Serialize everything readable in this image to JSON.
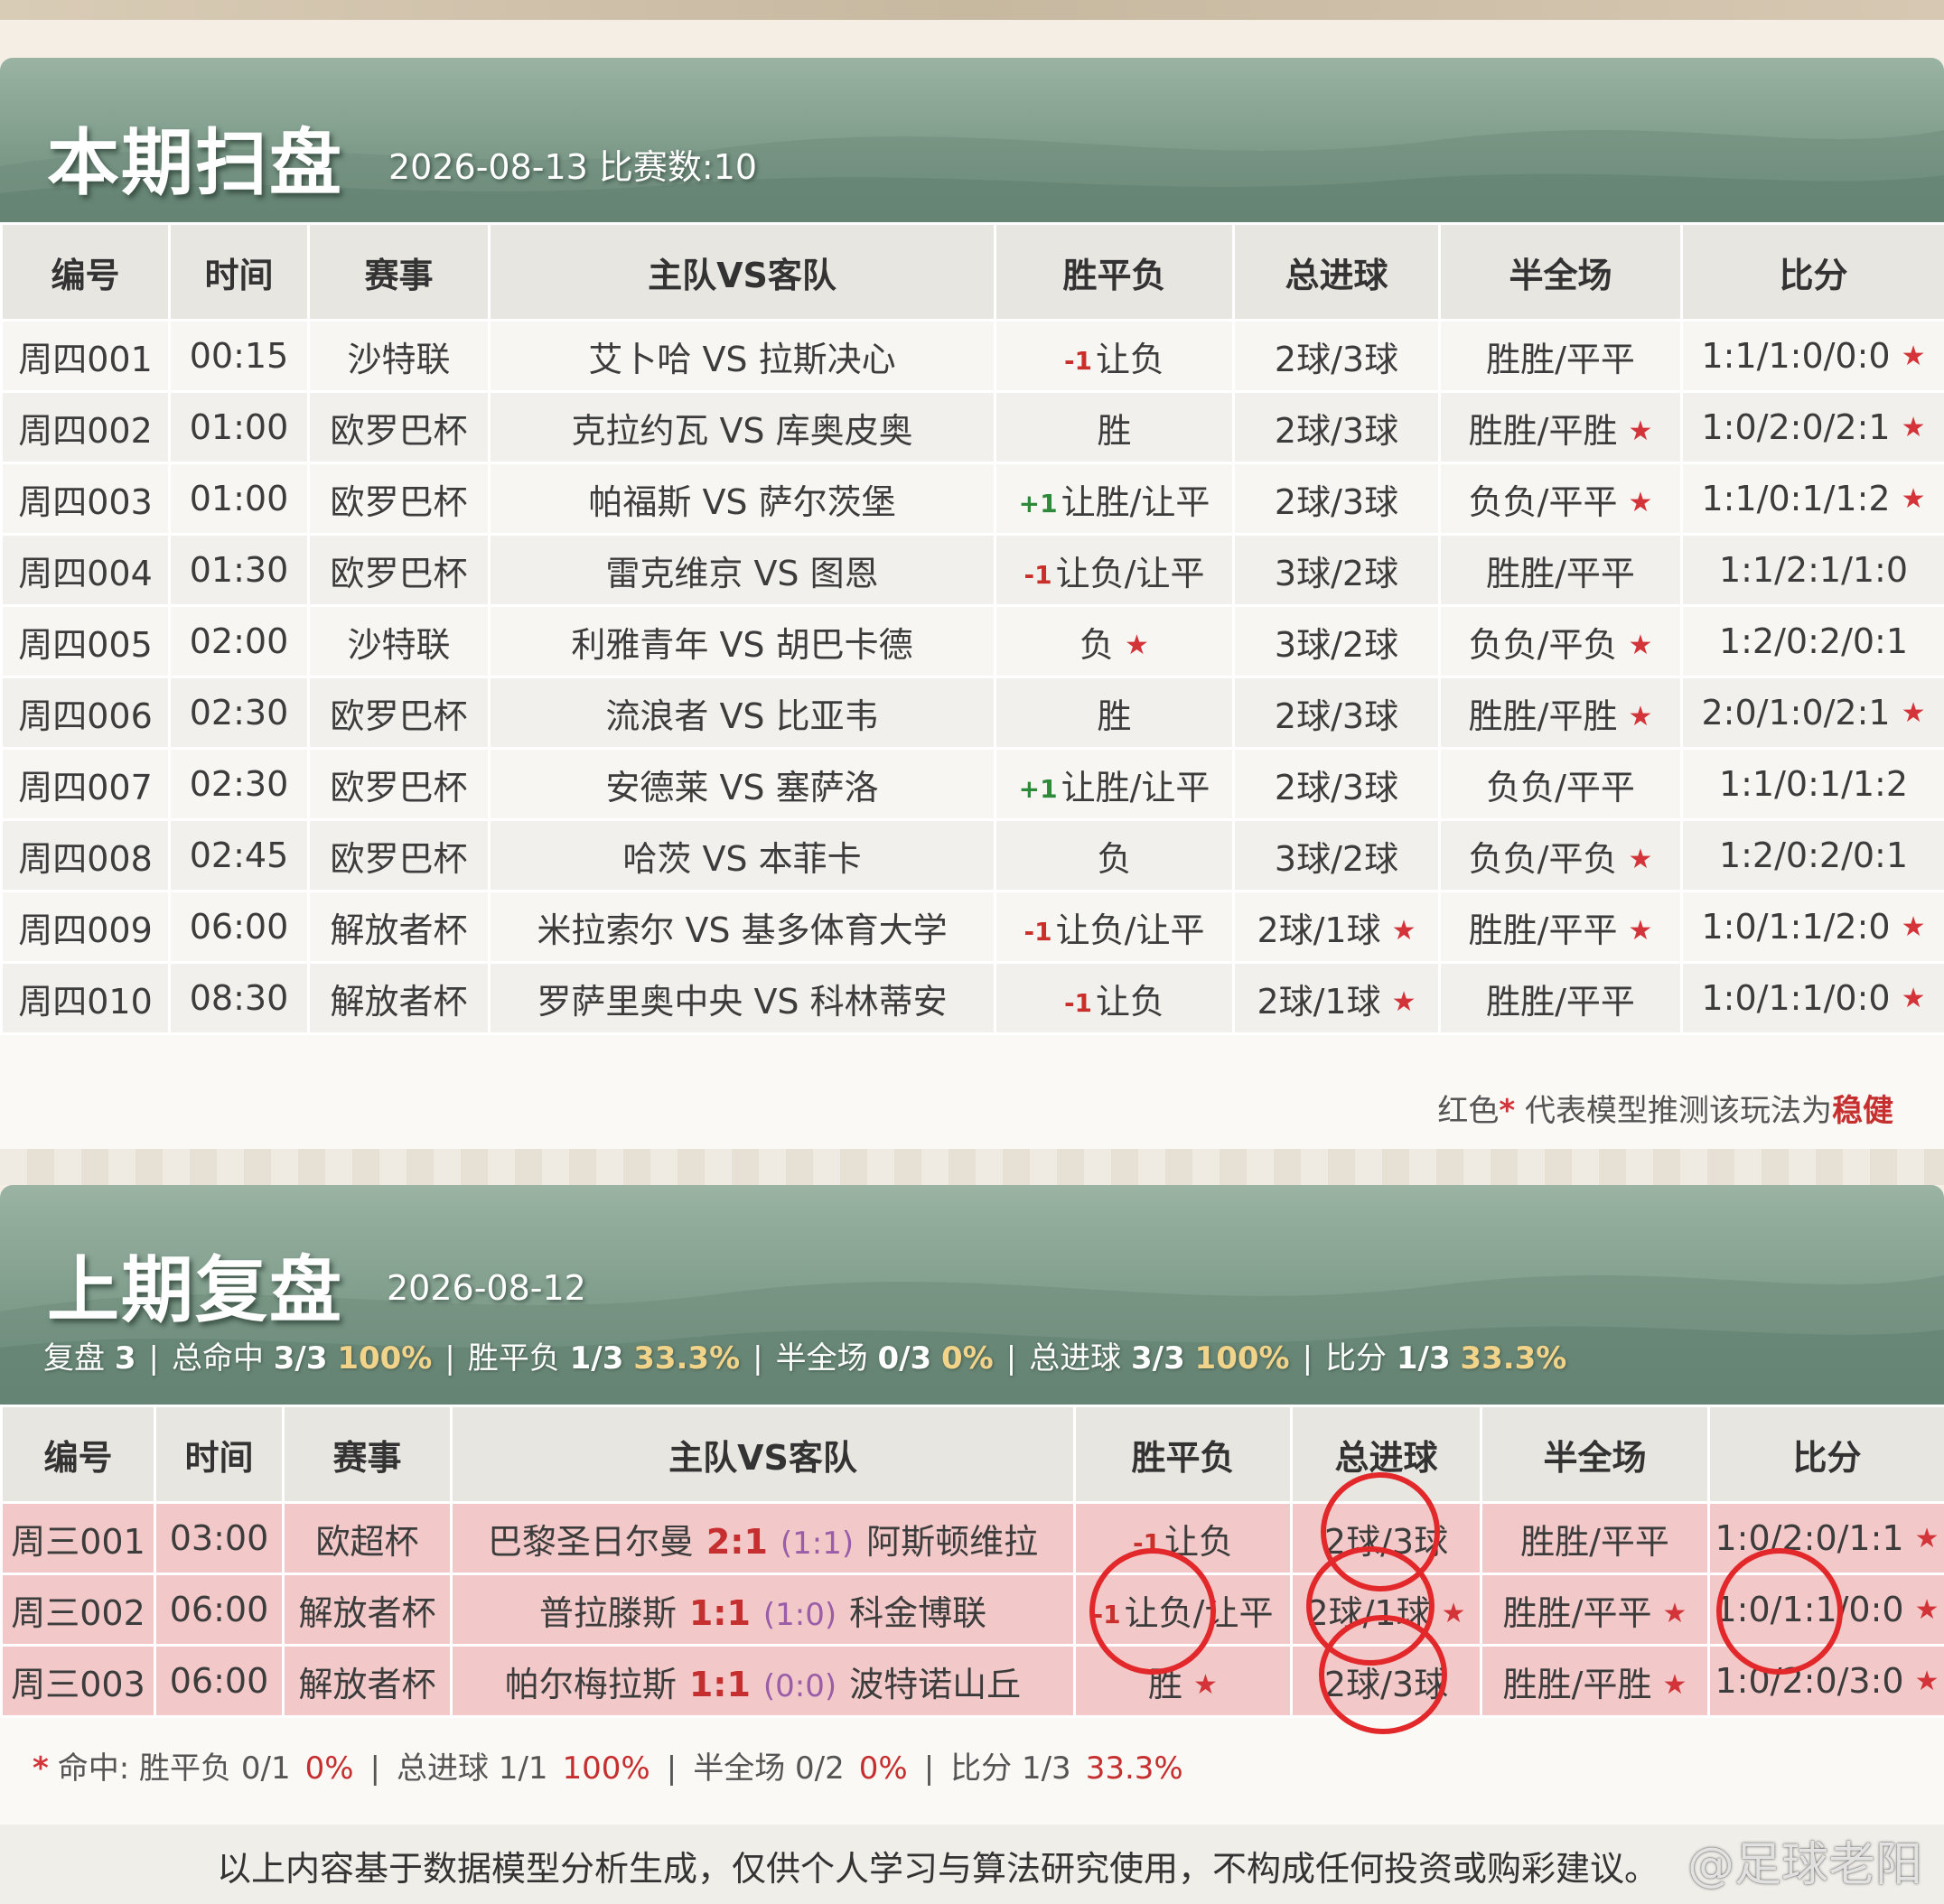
{
  "current": {
    "title": "本期扫盘",
    "subtitle": "2026-08-13 比赛数:10",
    "headers": [
      "编号",
      "时间",
      "赛事",
      "主队VS客队",
      "胜平负",
      "总进球",
      "半全场",
      "比分"
    ],
    "rows": [
      {
        "id": "周四001",
        "time": "00:15",
        "league": "沙特联",
        "match": "艾卜哈 VS 拉斯决心",
        "hcap": "-1",
        "wdl": "让负",
        "wdl_star": false,
        "goals": "2球/3球",
        "goals_star": false,
        "hf": "胜胜/平平",
        "hf_star": false,
        "score": "1:1/1:0/0:0",
        "score_star": true
      },
      {
        "id": "周四002",
        "time": "01:00",
        "league": "欧罗巴杯",
        "match": "克拉约瓦 VS 库奥皮奥",
        "hcap": "",
        "wdl": "胜",
        "wdl_star": false,
        "goals": "2球/3球",
        "goals_star": false,
        "hf": "胜胜/平胜",
        "hf_star": true,
        "score": "1:0/2:0/2:1",
        "score_star": true
      },
      {
        "id": "周四003",
        "time": "01:00",
        "league": "欧罗巴杯",
        "match": "帕福斯 VS 萨尔茨堡",
        "hcap": "+1",
        "wdl": "让胜/让平",
        "wdl_star": false,
        "goals": "2球/3球",
        "goals_star": false,
        "hf": "负负/平平",
        "hf_star": true,
        "score": "1:1/0:1/1:2",
        "score_star": true
      },
      {
        "id": "周四004",
        "time": "01:30",
        "league": "欧罗巴杯",
        "match": "雷克维京 VS 图恩",
        "hcap": "-1",
        "wdl": "让负/让平",
        "wdl_star": false,
        "goals": "3球/2球",
        "goals_star": false,
        "hf": "胜胜/平平",
        "hf_star": false,
        "score": "1:1/2:1/1:0",
        "score_star": false
      },
      {
        "id": "周四005",
        "time": "02:00",
        "league": "沙特联",
        "match": "利雅青年 VS 胡巴卡德",
        "hcap": "",
        "wdl": "负",
        "wdl_star": true,
        "goals": "3球/2球",
        "goals_star": false,
        "hf": "负负/平负",
        "hf_star": true,
        "score": "1:2/0:2/0:1",
        "score_star": false
      },
      {
        "id": "周四006",
        "time": "02:30",
        "league": "欧罗巴杯",
        "match": "流浪者 VS 比亚韦",
        "hcap": "",
        "wdl": "胜",
        "wdl_star": false,
        "goals": "2球/3球",
        "goals_star": false,
        "hf": "胜胜/平胜",
        "hf_star": true,
        "score": "2:0/1:0/2:1",
        "score_star": true
      },
      {
        "id": "周四007",
        "time": "02:30",
        "league": "欧罗巴杯",
        "match": "安德莱 VS 塞萨洛",
        "hcap": "+1",
        "wdl": "让胜/让平",
        "wdl_star": false,
        "goals": "2球/3球",
        "goals_star": false,
        "hf": "负负/平平",
        "hf_star": false,
        "score": "1:1/0:1/1:2",
        "score_star": false
      },
      {
        "id": "周四008",
        "time": "02:45",
        "league": "欧罗巴杯",
        "match": "哈茨 VS 本菲卡",
        "hcap": "",
        "wdl": "负",
        "wdl_star": false,
        "goals": "3球/2球",
        "goals_star": false,
        "hf": "负负/平负",
        "hf_star": true,
        "score": "1:2/0:2/0:1",
        "score_star": false
      },
      {
        "id": "周四009",
        "time": "06:00",
        "league": "解放者杯",
        "match": "米拉索尔 VS 基多体育大学",
        "hcap": "-1",
        "wdl": "让负/让平",
        "wdl_star": false,
        "goals": "2球/1球",
        "goals_star": true,
        "hf": "胜胜/平平",
        "hf_star": true,
        "score": "1:0/1:1/2:0",
        "score_star": true
      },
      {
        "id": "周四010",
        "time": "08:30",
        "league": "解放者杯",
        "match": "罗萨里奥中央 VS 科林蒂安",
        "hcap": "-1",
        "wdl": "让负",
        "wdl_star": false,
        "goals": "2球/1球",
        "goals_star": true,
        "hf": "胜胜/平平",
        "hf_star": false,
        "score": "1:0/1:1/0:0",
        "score_star": true
      }
    ],
    "note": {
      "prefix": "红色",
      "star": "*",
      "middle": " 代表模型推测该玩法为",
      "bold": "稳健"
    }
  },
  "previous": {
    "title": "上期复盘",
    "subtitle": "2026-08-12",
    "stats": [
      {
        "label": "复盘",
        "value": "3",
        "pct": ""
      },
      {
        "label": "总命中",
        "value": "3/3",
        "pct": "100%"
      },
      {
        "label": "胜平负",
        "value": "1/3",
        "pct": "33.3%"
      },
      {
        "label": "半全场",
        "value": "0/3",
        "pct": "0%"
      },
      {
        "label": "总进球",
        "value": "3/3",
        "pct": "100%"
      },
      {
        "label": "比分",
        "value": "1/3",
        "pct": "33.3%"
      }
    ],
    "headers": [
      "编号",
      "时间",
      "赛事",
      "主队VS客队",
      "胜平负",
      "总进球",
      "半全场",
      "比分"
    ],
    "rows": [
      {
        "id": "周三001",
        "time": "03:00",
        "league": "欧超杯",
        "home": "巴黎圣日尔曼",
        "score": "2:1",
        "half": "(1:1)",
        "away": "阿斯顿维拉",
        "hcap": "-1",
        "wdl": "让负",
        "wdl_star": false,
        "goals": "2球/3球",
        "goals_star": false,
        "hf": "胜胜/平平",
        "hf_star": false,
        "sc": "1:0/2:0/1:1",
        "sc_star": true
      },
      {
        "id": "周三002",
        "time": "06:00",
        "league": "解放者杯",
        "home": "普拉滕斯",
        "score": "1:1",
        "half": "(1:0)",
        "away": "科金博联",
        "hcap": "-1",
        "wdl": "让负/让平",
        "wdl_star": false,
        "goals": "2球/1球",
        "goals_star": true,
        "hf": "胜胜/平平",
        "hf_star": true,
        "sc": "1:0/1:1/0:0",
        "sc_star": true
      },
      {
        "id": "周三003",
        "time": "06:00",
        "league": "解放者杯",
        "home": "帕尔梅拉斯",
        "score": "1:1",
        "half": "(0:0)",
        "away": "波特诺山丘",
        "hcap": "",
        "wdl": "胜",
        "wdl_star": true,
        "goals": "2球/3球",
        "goals_star": false,
        "hf": "胜胜/平胜",
        "hf_star": true,
        "sc": "1:0/2:0/3:0",
        "sc_star": true
      }
    ],
    "hits": {
      "star": "*",
      "label": "命中:",
      "items": [
        {
          "label": "胜平负 0/1",
          "pct": "0%"
        },
        {
          "label": "总进球 1/1",
          "pct": "100%"
        },
        {
          "label": "半全场 0/2",
          "pct": "0%"
        },
        {
          "label": "比分 1/3",
          "pct": "33.3%"
        }
      ]
    },
    "footer": "以上内容基于数据模型分析生成，仅供个人学习与算法研究使用，不构成任何投资或购彩建议。"
  },
  "watermark": "@足球老阳",
  "colors": {
    "banner": "#7f9c8b",
    "star": "#d2343a",
    "row_hit": "#f2c9c8",
    "circle": "#e2282a"
  },
  "icons": {
    "star": "red-star-icon",
    "hills": "ink-mountain-decoration"
  }
}
